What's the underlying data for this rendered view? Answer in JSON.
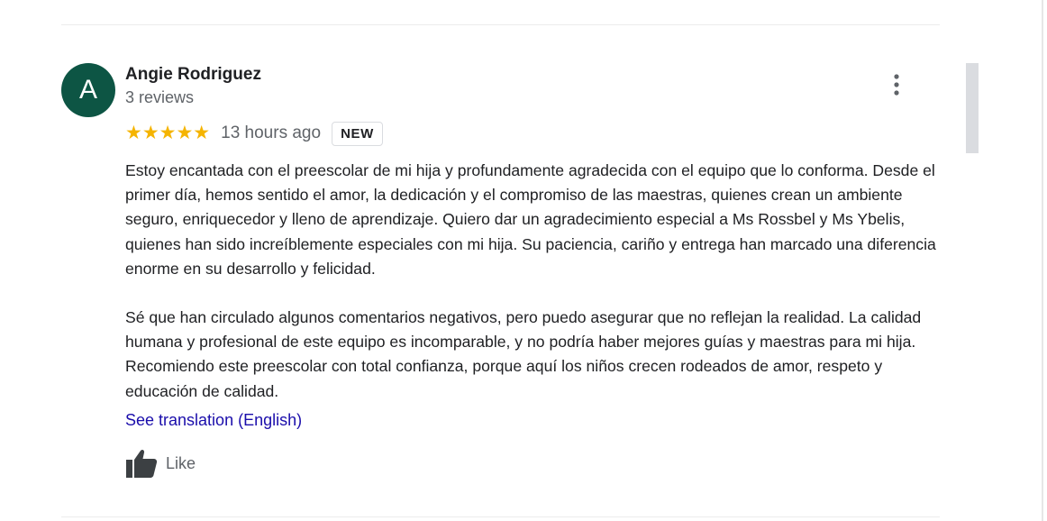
{
  "review": {
    "avatar_letter": "A",
    "avatar_color": "#0d5544",
    "author_name": "Angie Rodriguez",
    "author_meta": "3 reviews",
    "rating": 5,
    "stars": "★★★★★",
    "star_color": "#f5b400",
    "time": "13 hours ago",
    "badge": "NEW",
    "more_icon": "more-vertical-icon",
    "paragraphs": [
      "Estoy encantada con el preescolar de mi hija y profundamente agradecida con el equipo que lo conforma. Desde el primer día, hemos sentido el amor, la dedicación y el compromiso de las maestras, quienes crean un ambiente seguro, enriquecedor y lleno de aprendizaje. Quiero dar un agradecimiento especial a Ms Rossbel y Ms Ybelis, quienes han sido increíblemente especiales con mi hija. Su paciencia, cariño y entrega han marcado una diferencia enorme en su desarrollo y felicidad.",
      "Sé que han circulado algunos comentarios negativos, pero puedo asegurar que no reflejan la realidad. La calidad humana y profesional de este equipo es incomparable, y no podría haber mejores guías y maestras para mi hija. Recomiendo este preescolar con total confianza, porque aquí los niños crecen rodeados de amor, respeto y educación de calidad."
    ],
    "translation_link": "See translation (English)",
    "link_color": "#1a0dab",
    "like_icon": "thumbs-up-icon",
    "like_label": "Like"
  }
}
